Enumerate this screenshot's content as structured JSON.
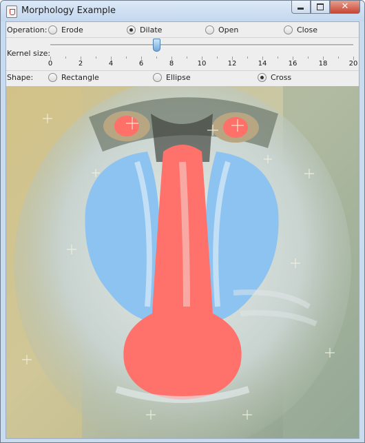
{
  "window": {
    "title": "Morphology Example"
  },
  "controls": {
    "operation_label": "Operation:",
    "operations": [
      {
        "label": "Erode",
        "checked": false
      },
      {
        "label": "Dilate",
        "checked": true
      },
      {
        "label": "Open",
        "checked": false
      },
      {
        "label": "Close",
        "checked": false
      }
    ],
    "kernel_label": "Kernel size:",
    "kernel_size": 7,
    "slider_min": 0,
    "slider_max": 20,
    "tick_labels": [
      "0",
      "2",
      "4",
      "6",
      "8",
      "10",
      "12",
      "14",
      "16",
      "18",
      "20"
    ],
    "shape_label": "Shape:",
    "shapes": [
      {
        "label": "Rectangle",
        "checked": false
      },
      {
        "label": "Ellipse",
        "checked": false
      },
      {
        "label": "Cross",
        "checked": true
      }
    ]
  },
  "image": {
    "subject": "dilated mandrill image"
  },
  "colors": {
    "nose_red": "#ff716b",
    "cheek_blue": "#8cc3f0",
    "fur_yellow": "#d3c48a",
    "fur_green": "#8ba08f"
  }
}
